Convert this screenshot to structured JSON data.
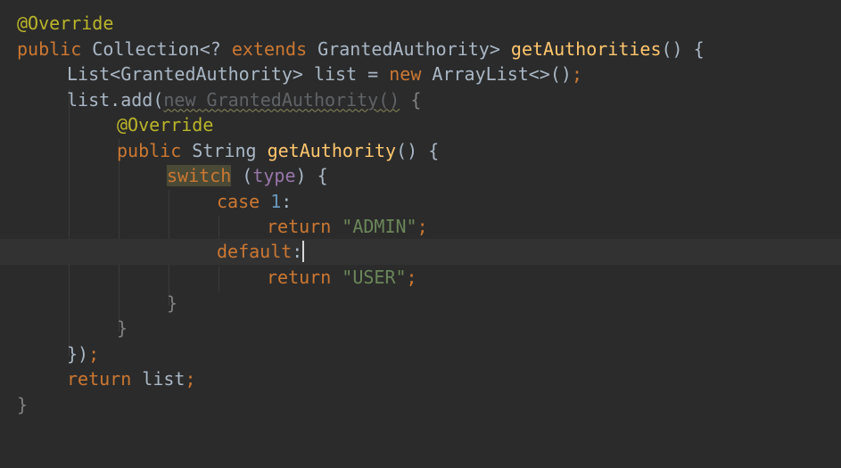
{
  "code": {
    "l1_annotation": "@Override",
    "l2_public": "public",
    "l2_type": "Collection<? ",
    "l2_extends": "extends",
    "l2_type2": " GrantedAuthority> ",
    "l2_method": "getAuthorities",
    "l2_parens": "() {",
    "l3_type": "List<GrantedAuthority> list = ",
    "l3_new": "new",
    "l3_rest": " ArrayList<>()",
    "l3_semi": ";",
    "l4_call": "list.add(",
    "l4_anon": "new GrantedAuthority()",
    "l4_brace": " {",
    "l5_annotation": "@Override",
    "l6_public": "public",
    "l6_type": " String ",
    "l6_method": "getAuthority",
    "l6_parens": "() {",
    "l7_switch": "switch",
    "l7_open": " (",
    "l7_field": "type",
    "l7_close": ") {",
    "l8_case": "case",
    "l8_num": "1",
    "l8_colon": ":",
    "l9_return": "return",
    "l9_str": "\"ADMIN\"",
    "l9_semi": ";",
    "l10_default": "default",
    "l10_colon": ":",
    "l11_return": "return",
    "l11_str": "\"USER\"",
    "l11_semi": ";",
    "l12_brace": "}",
    "l13_brace": "}",
    "l14_close": "})",
    "l14_semi": ";",
    "l15_return": "return",
    "l15_rest": " list",
    "l15_semi": ";",
    "l16_brace": "}"
  }
}
